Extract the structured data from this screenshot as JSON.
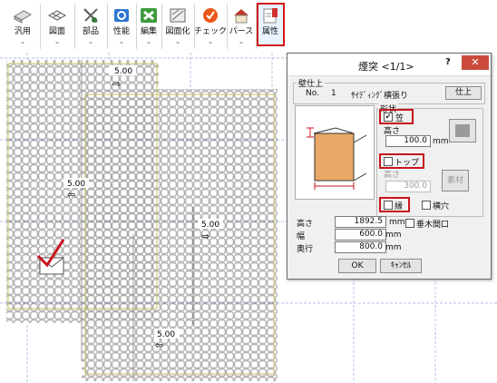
{
  "toolbar": {
    "buttons": [
      {
        "label": "汎用",
        "icon": "multipurpose-icon"
      },
      {
        "label": "図面",
        "icon": "drawing-icon"
      },
      {
        "label": "部品",
        "icon": "parts-icon"
      },
      {
        "label": "性能",
        "icon": "performance-icon"
      },
      {
        "label": "編集",
        "icon": "edit-icon"
      },
      {
        "label": "図面化",
        "icon": "drawing-conversion-icon"
      },
      {
        "label": "チェック",
        "icon": "check-icon"
      },
      {
        "label": "パース",
        "icon": "perspective-icon"
      },
      {
        "label": "属性",
        "icon": "attribute-icon"
      }
    ]
  },
  "canvas": {
    "dimension_labels": [
      "5.00",
      "5.00",
      "5.00",
      "5.00"
    ]
  },
  "dialog": {
    "title": "煙突 <1/1>",
    "help": "?",
    "close": "✕",
    "wall_group": {
      "title": "壁仕上",
      "no_label": "No.",
      "no_value": "1",
      "finish_name": "ｻｲﾃﾞｨﾝｸﾞ横張り",
      "finish_button": "仕上"
    },
    "shape": {
      "group_title": "形状",
      "kasa_label": "笠",
      "kasa_checked": true,
      "height_label": "高さ",
      "kasa_height": "100.0",
      "kasa_unit": "mm",
      "top_label": "トップ",
      "top_checked": false,
      "top_height_label": "高さ",
      "top_height": "300.0",
      "material_button": "素材",
      "edge_label": "縁",
      "edge_checked": false,
      "side_hole_label": "横穴",
      "side_hole_checked": false
    },
    "dimensions": {
      "height_label": "高さ",
      "height_value": "1892.5",
      "height_unit": "mm",
      "vertical_opening_label": "垂木間口",
      "vertical_opening_checked": false,
      "width_label": "幅",
      "width_value": "600.0",
      "width_unit": "mm",
      "depth_label": "奥行",
      "depth_value": "800.0",
      "depth_unit": "mm"
    },
    "ok": "OK",
    "cancel": "ｷｬﾝｾﾙ"
  },
  "colors": {
    "highlight": "#c8151c",
    "brick_fill": "#e9a867",
    "tile_stroke": "#8c8c8c",
    "grid_dash": "#9aa8e0",
    "close_red": "#c94a3c"
  }
}
